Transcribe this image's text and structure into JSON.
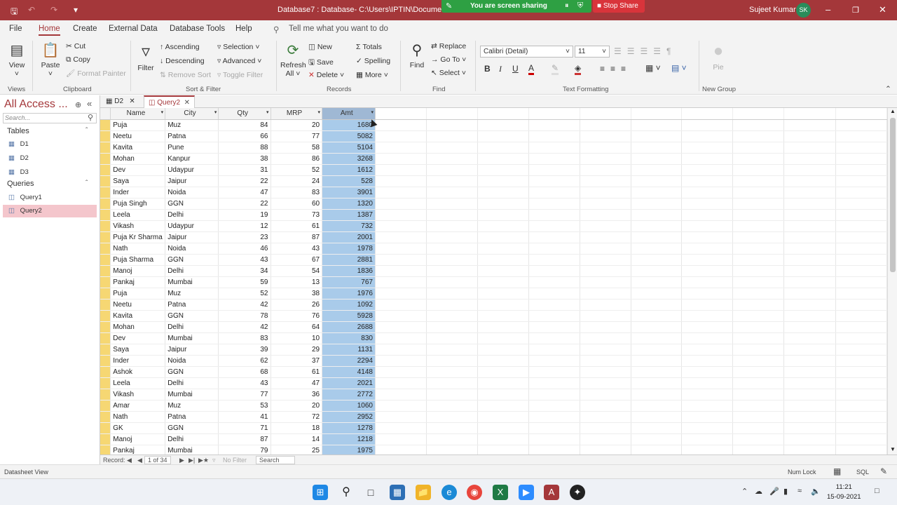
{
  "titlebar": {
    "title": "Database7 : Database- C:\\Users\\IPTIN\\Documents\\Da",
    "user": "Sujeet Kumar",
    "avatar": "SK"
  },
  "share": {
    "message": "You are screen sharing",
    "stop_label": "Stop Share"
  },
  "menu": [
    "File",
    "Home",
    "Create",
    "External Data",
    "Database Tools",
    "Help"
  ],
  "tell_me": "Tell me what you want to do",
  "ribbon": {
    "view": "View",
    "paste": "Paste",
    "cut": "Cut",
    "copy": "Copy",
    "format_painter": "Format Painter",
    "filter": "Filter",
    "ascending": "Ascending",
    "descending": "Descending",
    "remove_sort": "Remove Sort",
    "selection": "Selection",
    "advanced": "Advanced",
    "toggle_filter": "Toggle Filter",
    "refresh": "Refresh",
    "refresh_all": "All",
    "new": "New",
    "save": "Save",
    "delete": "Delete",
    "totals": "Totals",
    "spelling": "Spelling",
    "more": "More",
    "find": "Find",
    "replace": "Replace",
    "goto": "Go To",
    "select": "Select",
    "font": "Calibri (Detail)",
    "font_size": "11",
    "pie": "Pie",
    "groups": {
      "views": "Views",
      "clipboard": "Clipboard",
      "sort_filter": "Sort & Filter",
      "records": "Records",
      "find": "Find",
      "text_formatting": "Text Formatting",
      "new_group": "New Group"
    }
  },
  "nav": {
    "title": "All Access ...",
    "search_placeholder": "Search...",
    "tables_label": "Tables",
    "tables": [
      "D1",
      "D2",
      "D3"
    ],
    "queries_label": "Queries",
    "queries": [
      "Query1",
      "Query2"
    ]
  },
  "doc_tabs": [
    "D2",
    "Query2"
  ],
  "columns": [
    "Name",
    "City",
    "Qty",
    "MRP",
    "Amt"
  ],
  "rows": [
    [
      "Puja",
      "Muz",
      "84",
      "20",
      "1680"
    ],
    [
      "Neetu",
      "Patna",
      "66",
      "77",
      "5082"
    ],
    [
      "Kavita",
      "Pune",
      "88",
      "58",
      "5104"
    ],
    [
      "Mohan",
      "Kanpur",
      "38",
      "86",
      "3268"
    ],
    [
      "Dev",
      "Udaypur",
      "31",
      "52",
      "1612"
    ],
    [
      "Saya",
      "Jaipur",
      "22",
      "24",
      "528"
    ],
    [
      "Inder",
      "Noida",
      "47",
      "83",
      "3901"
    ],
    [
      "Puja Singh",
      "GGN",
      "22",
      "60",
      "1320"
    ],
    [
      "Leela",
      "Delhi",
      "19",
      "73",
      "1387"
    ],
    [
      "Vikash",
      "Udaypur",
      "12",
      "61",
      "732"
    ],
    [
      "Puja  Kr Sharma",
      "Jaipur",
      "23",
      "87",
      "2001"
    ],
    [
      "Nath",
      "Noida",
      "46",
      "43",
      "1978"
    ],
    [
      "Puja Sharma",
      "GGN",
      "43",
      "67",
      "2881"
    ],
    [
      "Manoj",
      "Delhi",
      "34",
      "54",
      "1836"
    ],
    [
      "Pankaj",
      "Mumbai",
      "59",
      "13",
      "767"
    ],
    [
      "Puja",
      "Muz",
      "52",
      "38",
      "1976"
    ],
    [
      "Neetu",
      "Patna",
      "42",
      "26",
      "1092"
    ],
    [
      "Kavita",
      "GGN",
      "78",
      "76",
      "5928"
    ],
    [
      "Mohan",
      "Delhi",
      "42",
      "64",
      "2688"
    ],
    [
      "Dev",
      "Mumbai",
      "83",
      "10",
      "830"
    ],
    [
      "Saya",
      "Jaipur",
      "39",
      "29",
      "1131"
    ],
    [
      "Inder",
      "Noida",
      "62",
      "37",
      "2294"
    ],
    [
      "Ashok",
      "GGN",
      "68",
      "61",
      "4148"
    ],
    [
      "Leela",
      "Delhi",
      "43",
      "47",
      "2021"
    ],
    [
      "Vikash",
      "Mumbai",
      "77",
      "36",
      "2772"
    ],
    [
      "Amar",
      "Muz",
      "53",
      "20",
      "1060"
    ],
    [
      "Nath",
      "Patna",
      "41",
      "72",
      "2952"
    ],
    [
      "GK",
      "GGN",
      "71",
      "18",
      "1278"
    ],
    [
      "Manoj",
      "Delhi",
      "87",
      "14",
      "1218"
    ],
    [
      "Pankaj",
      "Mumbai",
      "79",
      "25",
      "1975"
    ]
  ],
  "record_bar": {
    "label": "Record:",
    "position": "1 of 34",
    "filter": "No Filter",
    "search": "Search"
  },
  "status": {
    "view": "Datasheet View",
    "numlock": "Num Lock",
    "sql": "SQL"
  },
  "clock": {
    "time": "11:21",
    "date": "15-09-2021"
  },
  "colors": {
    "accent": "#a4373a",
    "share_green": "#2ea043",
    "stop_red": "#d9343b",
    "selected_column": "#a9cbea",
    "row_selector": "#f6d773"
  }
}
